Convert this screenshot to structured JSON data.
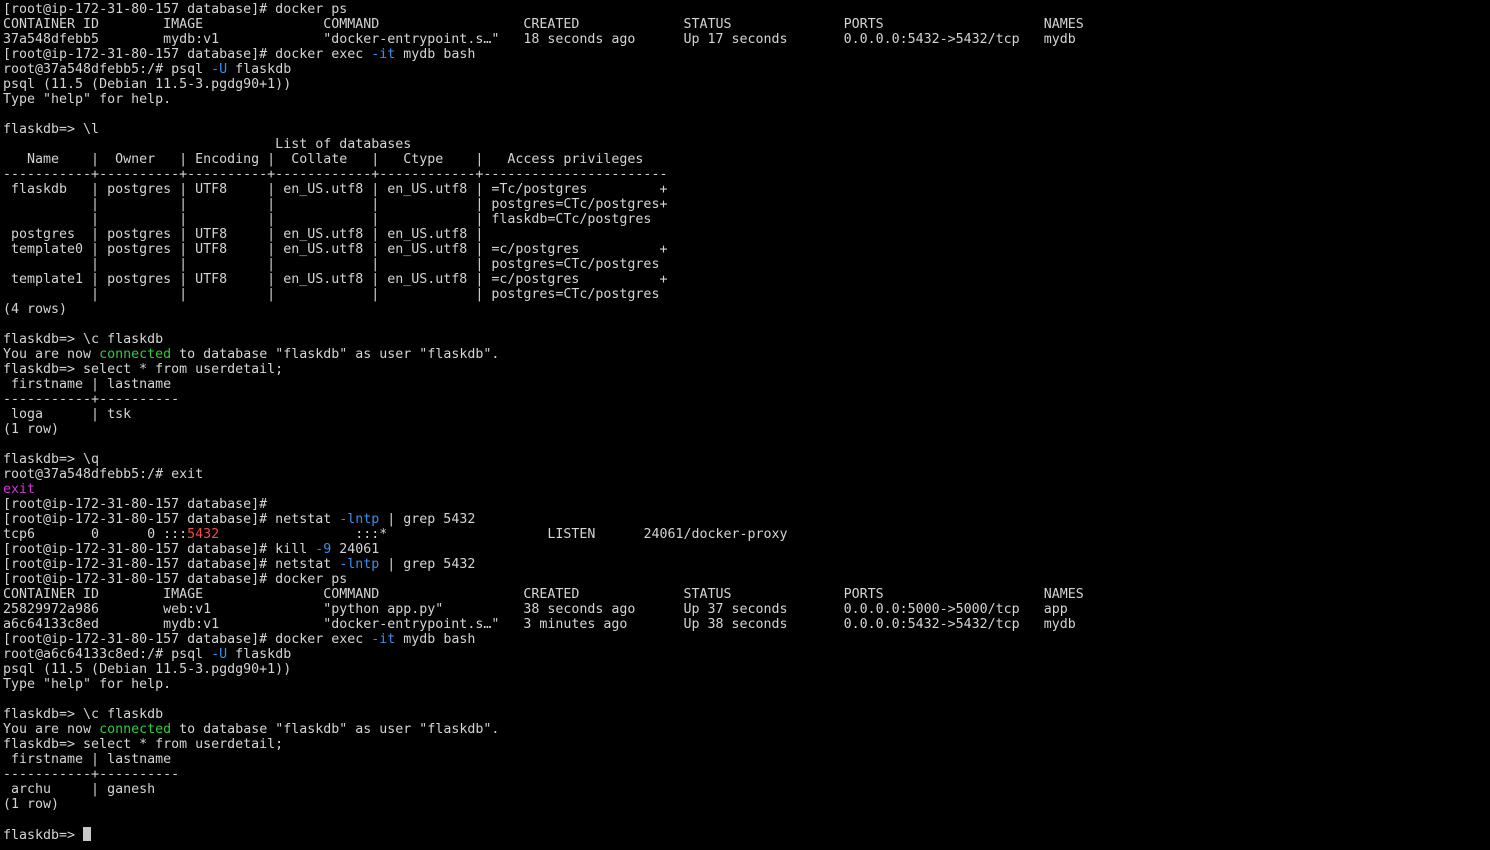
{
  "terminal": {
    "colors": {
      "background": "#000000",
      "text": "#d4d4d4",
      "green": "#2ecc40",
      "blue": "#3b8eea",
      "magenta": "#d234d2",
      "red": "#f14c4c"
    },
    "cursor_icon": "block-cursor",
    "lines": [
      [
        {
          "t": "[root@ip-172-31-80-157 database]# docker ps"
        }
      ],
      [
        {
          "t": "CONTAINER ID        IMAGE               COMMAND                  CREATED             STATUS              PORTS                    NAMES"
        }
      ],
      [
        {
          "t": "37a548dfebb5        mydb:v1             \"docker-entrypoint.s…\"   18 seconds ago      Up 17 seconds       0.0.0.0:5432->5432/tcp   mydb"
        }
      ],
      [
        {
          "t": "[root@ip-172-31-80-157 database]# docker exec "
        },
        {
          "t": "-it",
          "c": "blue"
        },
        {
          "t": " mydb bash"
        }
      ],
      [
        {
          "t": "root@37a548dfebb5:/# psql "
        },
        {
          "t": "-U",
          "c": "blue"
        },
        {
          "t": " flaskdb"
        }
      ],
      [
        {
          "t": "psql (11.5 (Debian 11.5-3.pgdg90+1))"
        }
      ],
      [
        {
          "t": "Type \"help\" for help."
        }
      ],
      [
        {
          "t": ""
        }
      ],
      [
        {
          "t": "flaskdb=> \\l"
        }
      ],
      [
        {
          "t": "                                  List of databases"
        }
      ],
      [
        {
          "t": "   Name    |  Owner   | Encoding |  Collate   |   Ctype    |   Access privileges"
        }
      ],
      [
        {
          "t": "-----------+----------+----------+------------+------------+-----------------------"
        }
      ],
      [
        {
          "t": " flaskdb   | postgres | UTF8     | en_US.utf8 | en_US.utf8 | =Tc/postgres         +"
        }
      ],
      [
        {
          "t": "           |          |          |            |            | postgres=CTc/postgres+"
        }
      ],
      [
        {
          "t": "           |          |          |            |            | flaskdb=CTc/postgres"
        }
      ],
      [
        {
          "t": " postgres  | postgres | UTF8     | en_US.utf8 | en_US.utf8 |"
        }
      ],
      [
        {
          "t": " template0 | postgres | UTF8     | en_US.utf8 | en_US.utf8 | =c/postgres          +"
        }
      ],
      [
        {
          "t": "           |          |          |            |            | postgres=CTc/postgres"
        }
      ],
      [
        {
          "t": " template1 | postgres | UTF8     | en_US.utf8 | en_US.utf8 | =c/postgres          +"
        }
      ],
      [
        {
          "t": "           |          |          |            |            | postgres=CTc/postgres"
        }
      ],
      [
        {
          "t": "(4 rows)"
        }
      ],
      [
        {
          "t": ""
        }
      ],
      [
        {
          "t": "flaskdb=> \\c flaskdb"
        }
      ],
      [
        {
          "t": "You are now "
        },
        {
          "t": "connected",
          "c": "green"
        },
        {
          "t": " to database \"flaskdb\" as user \"flaskdb\"."
        }
      ],
      [
        {
          "t": "flaskdb=> select * from userdetail;"
        }
      ],
      [
        {
          "t": " firstname | lastname"
        }
      ],
      [
        {
          "t": "-----------+----------"
        }
      ],
      [
        {
          "t": " loga      | tsk"
        }
      ],
      [
        {
          "t": "(1 row)"
        }
      ],
      [
        {
          "t": ""
        }
      ],
      [
        {
          "t": "flaskdb=> \\q"
        }
      ],
      [
        {
          "t": "root@37a548dfebb5:/# exit"
        }
      ],
      [
        {
          "t": "exit",
          "c": "magenta"
        }
      ],
      [
        {
          "t": "[root@ip-172-31-80-157 database]#"
        }
      ],
      [
        {
          "t": "[root@ip-172-31-80-157 database]# netstat "
        },
        {
          "t": "-lntp",
          "c": "blue"
        },
        {
          "t": " | grep 5432"
        }
      ],
      [
        {
          "t": "tcp6       0      0 :::"
        },
        {
          "t": "5432",
          "c": "red"
        },
        {
          "t": "                 :::*                    LISTEN      24061/docker-proxy"
        }
      ],
      [
        {
          "t": "[root@ip-172-31-80-157 database]# kill "
        },
        {
          "t": "-9",
          "c": "blue"
        },
        {
          "t": " 24061"
        }
      ],
      [
        {
          "t": "[root@ip-172-31-80-157 database]# netstat "
        },
        {
          "t": "-lntp",
          "c": "blue"
        },
        {
          "t": " | grep 5432"
        }
      ],
      [
        {
          "t": "[root@ip-172-31-80-157 database]# docker ps"
        }
      ],
      [
        {
          "t": "CONTAINER ID        IMAGE               COMMAND                  CREATED             STATUS              PORTS                    NAMES"
        }
      ],
      [
        {
          "t": "25829972a986        web:v1              \"python app.py\"          38 seconds ago      Up 37 seconds       0.0.0.0:5000->5000/tcp   app"
        }
      ],
      [
        {
          "t": "a6c64133c8ed        mydb:v1             \"docker-entrypoint.s…\"   3 minutes ago       Up 38 seconds       0.0.0.0:5432->5432/tcp   mydb"
        }
      ],
      [
        {
          "t": "[root@ip-172-31-80-157 database]# docker exec "
        },
        {
          "t": "-it",
          "c": "blue"
        },
        {
          "t": " mydb bash"
        }
      ],
      [
        {
          "t": "root@a6c64133c8ed:/# psql "
        },
        {
          "t": "-U",
          "c": "blue"
        },
        {
          "t": " flaskdb"
        }
      ],
      [
        {
          "t": "psql (11.5 (Debian 11.5-3.pgdg90+1))"
        }
      ],
      [
        {
          "t": "Type \"help\" for help."
        }
      ],
      [
        {
          "t": ""
        }
      ],
      [
        {
          "t": "flaskdb=> \\c flaskdb"
        }
      ],
      [
        {
          "t": "You are now "
        },
        {
          "t": "connected",
          "c": "green"
        },
        {
          "t": " to database \"flaskdb\" as user \"flaskdb\"."
        }
      ],
      [
        {
          "t": "flaskdb=> select * from userdetail;"
        }
      ],
      [
        {
          "t": " firstname | lastname"
        }
      ],
      [
        {
          "t": "-----------+----------"
        }
      ],
      [
        {
          "t": " archu     | ganesh"
        }
      ],
      [
        {
          "t": "(1 row)"
        }
      ],
      [
        {
          "t": ""
        }
      ],
      [
        {
          "t": "flaskdb=> "
        }
      ]
    ]
  }
}
